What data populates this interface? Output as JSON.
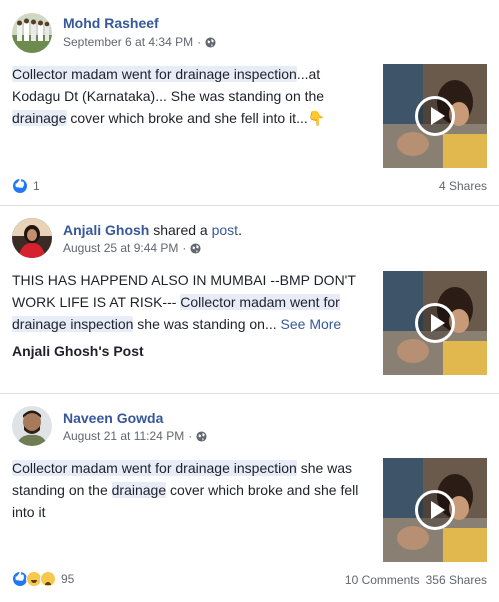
{
  "posts": [
    {
      "author": "Mohd Rasheef",
      "date": "September 6 at 4:34 PM",
      "separator": "·",
      "text_hl1": "Collector madam went for drainage inspection",
      "text_p1": "...at Kodagu Dt (Karnataka)... She was standing on the ",
      "text_hl2": "drainage",
      "text_p2": " cover which broke and she fell into it...",
      "emoji": "👇",
      "reaction_count": "1",
      "shares": "4 Shares"
    },
    {
      "author": "Anjali Ghosh",
      "shared_word": " shared a ",
      "shared_link": "post",
      "shared_end": ".",
      "date": "August 25 at 9:44 PM",
      "separator": "·",
      "text_p0": "THIS HAS HAPPEND ALSO IN MUMBAI --BMP DON'T WORK LIFE IS AT RISK--- ",
      "text_hl1": "Collector madam went for drainage inspection",
      "text_p1": " she was standing on...",
      "see_more": "See More",
      "sub_title": "Anjali Ghosh's Post"
    },
    {
      "author": "Naveen Gowda",
      "date": "August 21 at 11:24 PM",
      "separator": "·",
      "text_hl1": "Collector madam went for drainage inspection",
      "text_p1": " she was standing on the ",
      "text_hl2": "drainage",
      "text_p2": " cover which broke and she fell into it",
      "reaction_count": "95",
      "comments": "10 Comments",
      "shares": "356 Shares"
    }
  ],
  "icons": {
    "globe": "globe-icon",
    "play": "play-icon",
    "like": "like-icon",
    "haha": "haha-icon",
    "sad": "sad-icon"
  },
  "colors": {
    "link": "#365899",
    "highlight": "#e7ecf6",
    "like_blue": "#2078f4",
    "meta_gray": "#616770"
  }
}
